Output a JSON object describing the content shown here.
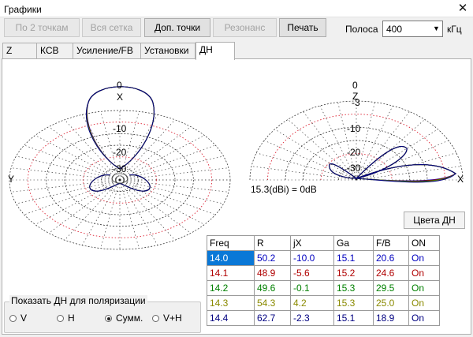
{
  "window": {
    "title": "Графики"
  },
  "toolbar": {
    "by2points": "По 2 точкам",
    "wholegrid": "Вся сетка",
    "extrapoints": "Доп. точки",
    "resonance": "Резонанс",
    "print": "Печать",
    "band_label": "Полоса",
    "band_value": "400",
    "band_unit": "кГц"
  },
  "tabs": [
    "Z",
    "КСВ",
    "Усиление/FB",
    "Установки",
    "ДН"
  ],
  "plot": {
    "left_labels": {
      "top": "0",
      "axis": "X",
      "m10": "-10",
      "m20": "-20",
      "m30": "-30",
      "side": "Y"
    },
    "right_labels": {
      "top": "0",
      "axis": "Z",
      "m3": "-3",
      "m10": "-10",
      "m20": "-20",
      "m30": "-30",
      "side": "X"
    },
    "gain_text": "15.3(dBi) = 0dB"
  },
  "colors_button": "Цвета ДН",
  "table": {
    "headers": [
      "Freq",
      "R",
      "jX",
      "Ga",
      "F/B",
      "ON"
    ],
    "rows": [
      {
        "cells": [
          "14.0",
          "50.2",
          "-10.0",
          "15.1",
          "20.6",
          "On"
        ],
        "color": "#0000c0"
      },
      {
        "cells": [
          "14.1",
          "48.9",
          "-5.6",
          "15.2",
          "24.6",
          "On"
        ],
        "color": "#b00000"
      },
      {
        "cells": [
          "14.2",
          "49.6",
          "-0.1",
          "15.3",
          "29.5",
          "On"
        ],
        "color": "#008000"
      },
      {
        "cells": [
          "14.3",
          "54.3",
          "4.2",
          "15.3",
          "25.0",
          "On"
        ],
        "color": "#8a8a00"
      },
      {
        "cells": [
          "14.4",
          "62.7",
          "-2.3",
          "15.1",
          "18.9",
          "On"
        ],
        "color": "#000080"
      }
    ]
  },
  "polarization": {
    "title": "Показать ДН для поляризации",
    "options": [
      "V",
      "H",
      "Сумм.",
      "V+H"
    ],
    "selected": "Сумм."
  },
  "series_colors": [
    "#0000c0",
    "#b00000",
    "#008000",
    "#8a8a00",
    "#000080"
  ]
}
